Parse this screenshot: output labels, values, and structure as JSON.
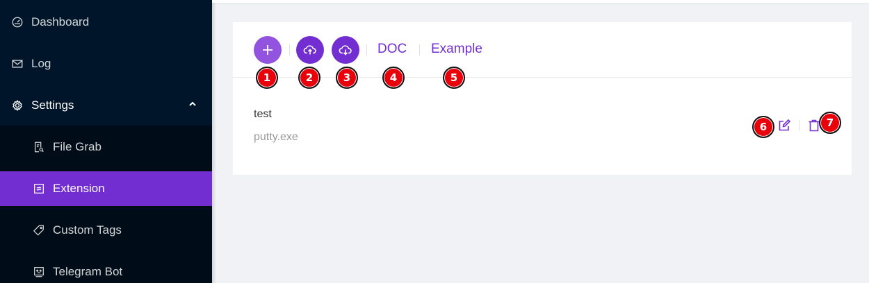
{
  "sidebar": {
    "items": [
      {
        "label": "Dashboard",
        "icon": "dashboard-icon"
      },
      {
        "label": "Log",
        "icon": "mail-icon"
      },
      {
        "label": "Settings",
        "icon": "gear-icon",
        "expanded": true
      },
      {
        "label": "File Grab",
        "icon": "file-search-icon"
      },
      {
        "label": "Extension",
        "icon": "extension-icon",
        "active": true
      },
      {
        "label": "Custom Tags",
        "icon": "tag-icon"
      },
      {
        "label": "Telegram Bot",
        "icon": "robot-icon"
      }
    ]
  },
  "toolbar": {
    "add_icon": "plus-icon",
    "upload_icon": "cloud-upload-icon",
    "download_icon": "cloud-download-icon",
    "doc_label": "DOC",
    "example_label": "Example"
  },
  "extension_item": {
    "title": "test",
    "subtitle": "putty.exe",
    "edit_icon": "edit-icon",
    "delete_icon": "delete-icon"
  },
  "annotations": [
    "1",
    "2",
    "3",
    "4",
    "5",
    "6",
    "7"
  ],
  "colors": {
    "sidebar_bg": "#001529",
    "submenu_bg": "#000c17",
    "accent": "#722ed1",
    "badge": "#e8000b",
    "page_bg": "#f0f2f5"
  }
}
